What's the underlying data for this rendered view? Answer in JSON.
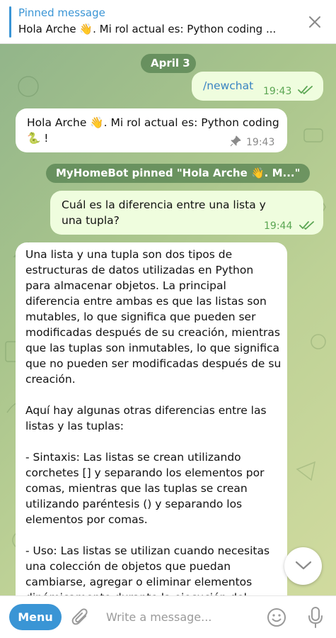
{
  "pinned": {
    "title": "Pinned message",
    "text": "Hola Arche 👋. Mi rol actual es: Python coding ..."
  },
  "chat": {
    "date_label": "April 3",
    "messages": [
      {
        "text": "/newchat",
        "time": "19:43"
      },
      {
        "text": "Hola Arche 👋. Mi rol actual es: Python coding 🐍 !",
        "time": "19:43"
      },
      {
        "text": "Cuál es la diferencia entre una lista y una tupla?",
        "time": "19:44"
      }
    ],
    "service_pin": "MyHomeBot pinned \"Hola Arche 👋. M...\"",
    "answer_paragraphs": [
      "Una lista y una tupla son dos tipos de estructuras de datos utilizadas en Python para almacenar objetos. La principal diferencia entre ambas es que las listas son mutables, lo que significa que pueden ser modificadas después de su creación, mientras que las tuplas son inmutables, lo que significa que no pueden ser modificadas después de su creación.",
      "Aquí hay algunas otras diferencias entre las listas y las tuplas:",
      "- Sintaxis: Las listas se crean utilizando corchetes [] y separando los elementos por comas, mientras que las tuplas se crean utilizando paréntesis () y separando los elementos por comas.",
      "- Uso: Las listas se utilizan cuando necesitas una colección de objetos que puedan cambiarse, agregar o eliminar elementos dinámicamente durante la ejecución del"
    ]
  },
  "composer": {
    "menu_label": "Menu",
    "placeholder": "Write a message..."
  },
  "colors": {
    "accent": "#3a95d5",
    "outgoing_bubble": "#effdde",
    "read_check": "#5ba653",
    "service_pill": "#568250"
  },
  "icons": [
    "close-icon",
    "double-check-icon",
    "pin-icon",
    "chevron-down-icon",
    "paperclip-icon",
    "smile-icon",
    "microphone-icon"
  ]
}
